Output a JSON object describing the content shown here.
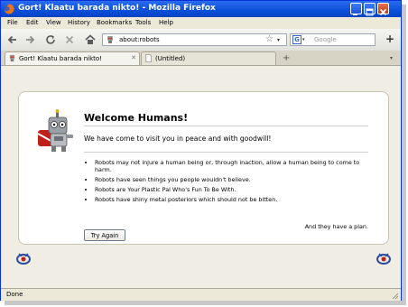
{
  "window": {
    "title": "Gort! Klaatu barada nikto! - Mozilla Firefox",
    "minimize_icon": "minimize-icon",
    "maximize_icon": "maximize-icon",
    "close_icon": "close-icon"
  },
  "menu": {
    "items": [
      "File",
      "Edit",
      "View",
      "History",
      "Bookmarks",
      "Tools",
      "Help"
    ]
  },
  "nav": {
    "url": "about:robots",
    "search_placeholder": "Google",
    "icons": [
      "back-icon",
      "forward-icon",
      "reload-icon",
      "stop-icon",
      "home-icon",
      "bookmark-star-icon",
      "new-tab-icon"
    ]
  },
  "tabs": [
    {
      "label": "Gort! Klaatu barada nikto!",
      "active": true
    },
    {
      "label": "(Untitled)",
      "active": false
    }
  ],
  "page": {
    "heading": "Welcome Humans!",
    "intro": "We have come to visit you in peace and with goodwill!",
    "laws": [
      "Robots may not injure a human being or, through inaction, allow a human being to come to harm.",
      "Robots have seen things you people wouldn't believe.",
      "Robots are Your Plastic Pal Who's Fun To Be With.",
      "Robots have shiny metal posteriors which should not be bitten."
    ],
    "plan": "And they have a plan.",
    "button": "Try Again"
  },
  "status": {
    "text": "Done"
  },
  "colors": {
    "titlebar": "#0a4fd8",
    "panel_border": "#c9c5b3",
    "content_bg": "#f0eee4"
  }
}
